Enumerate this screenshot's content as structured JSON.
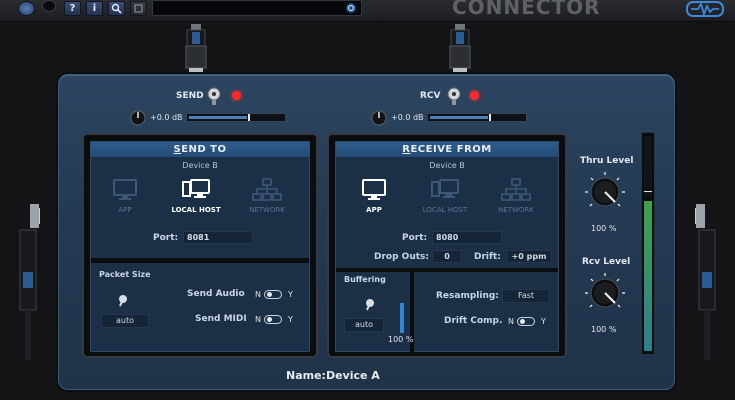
{
  "toolbar": {
    "help_label": "?",
    "info_label": "i",
    "search_icon": "magnifier-icon",
    "page_icon": "page-icon"
  },
  "brand": "CONNECTOR",
  "send": {
    "label": "SEND",
    "gain": "+0.0 dB",
    "panel": {
      "title_accel": "S",
      "title_rest": "END TO",
      "device": "Device B",
      "modes": [
        "APP",
        "LOCAL HOST",
        "NETWORK"
      ],
      "selected_mode": "LOCAL HOST",
      "port_label": "Port:",
      "port_value": "8081",
      "packet_size_label": "Packet Size",
      "packet_size_value": "auto",
      "send_audio_label": "Send Audio",
      "send_midi_label": "Send MIDI",
      "toggle_n": "N",
      "toggle_y": "Y"
    }
  },
  "receive": {
    "label": "RCV",
    "gain": "+0.0 dB",
    "panel": {
      "title_accel": "R",
      "title_rest": "ECEIVE FROM",
      "device": "Device B",
      "modes": [
        "APP",
        "LOCAL HOST",
        "NETWORK"
      ],
      "selected_mode": "APP",
      "port_label": "Port:",
      "port_value": "8080",
      "dropouts_label": "Drop Outs:",
      "dropouts_value": "0",
      "drift_label": "Drift:",
      "drift_value": "+0 ppm",
      "buffering_label": "Buffering",
      "buffering_value": "auto",
      "buffer_percent": "100 %",
      "resampling_label": "Resampling:",
      "resampling_value": "Fast",
      "drift_comp_label": "Drift Comp.",
      "toggle_n": "N",
      "toggle_y": "Y"
    }
  },
  "thru_level": {
    "label": "Thru Level",
    "value": "100 %"
  },
  "rcv_level": {
    "label": "Rcv Level",
    "value": "100 %"
  },
  "name": "Name:Device A",
  "colors": {
    "accent": "#2e5d8e",
    "led_red": "#ff2a2a",
    "meter_green": "#3fa14a"
  }
}
